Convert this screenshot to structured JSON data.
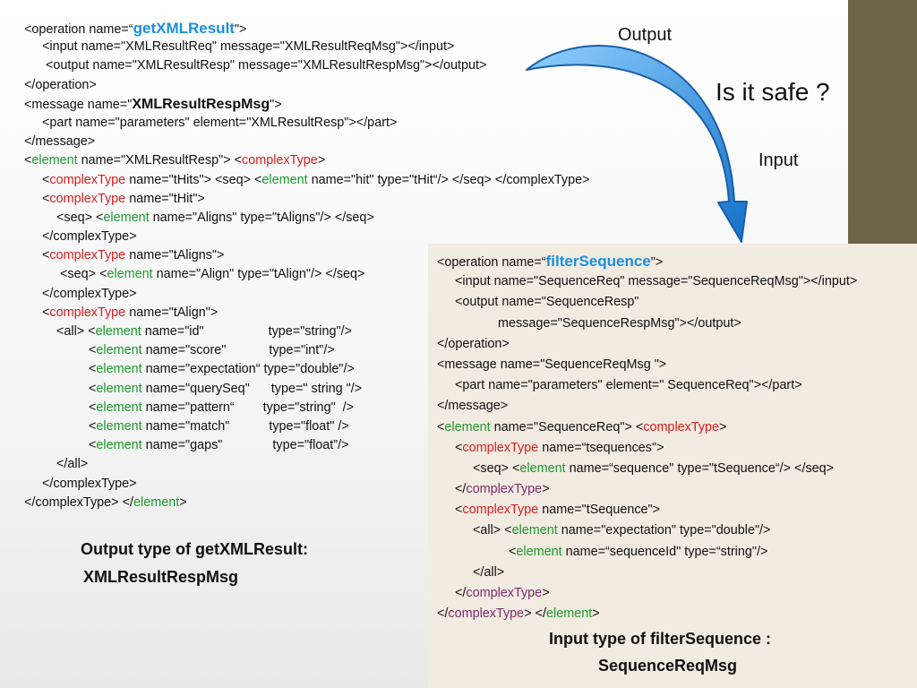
{
  "labels": {
    "output": "Output",
    "input": "Input",
    "question": "Is it safe ?"
  },
  "left_code": [
    [
      {
        "t": "<operation name=“"
      },
      {
        "t": "getXMLResult",
        "c": "hl"
      },
      {
        "t": "\">"
      }
    ],
    [
      {
        "t": "     <input name=\"XMLResultReq\" message=\"XMLResultReqMsg\"></input>"
      }
    ],
    [
      {
        "t": "      <output name=\"XMLResultResp\" message=\"XMLResultRespMsg\"></output>"
      }
    ],
    [
      {
        "t": "</operation>"
      }
    ],
    [
      {
        "t": "<message name=\""
      },
      {
        "t": "XMLResultRespMsg",
        "c": "bold"
      },
      {
        "t": "\">"
      }
    ],
    [
      {
        "t": "     <part name=\"parameters\" element=\"XMLResultResp\"></part>"
      }
    ],
    [
      {
        "t": "</message>"
      }
    ],
    [
      {
        "t": "<"
      },
      {
        "t": "element",
        "c": "kw-green"
      },
      {
        "t": " name=\"XMLResultResp\"> <"
      },
      {
        "t": "complexType",
        "c": "kw-red"
      },
      {
        "t": ">"
      }
    ],
    [
      {
        "t": "     <"
      },
      {
        "t": "complexType",
        "c": "kw-red"
      },
      {
        "t": " name=\"tHits\"> <seq> <"
      },
      {
        "t": "element",
        "c": "kw-green"
      },
      {
        "t": " name=\"hit\" type=\"tHit“/> </seq> </complexType>"
      }
    ],
    [
      {
        "t": "     <"
      },
      {
        "t": "complexType",
        "c": "kw-red"
      },
      {
        "t": " name=\"tHit\">"
      }
    ],
    [
      {
        "t": "         <seq> <"
      },
      {
        "t": "element",
        "c": "kw-green"
      },
      {
        "t": " name=\"Aligns\" type=\"tAligns\"/> </seq>"
      }
    ],
    [
      {
        "t": "     </complexType>"
      }
    ],
    [
      {
        "t": "     <"
      },
      {
        "t": "complexType",
        "c": "kw-red"
      },
      {
        "t": " name=\"tAligns\">"
      }
    ],
    [
      {
        "t": "          <seq> <"
      },
      {
        "t": "element",
        "c": "kw-green"
      },
      {
        "t": " name=\"Align\" type=\"tAlign\"/> </seq>"
      }
    ],
    [
      {
        "t": "     </complexType>"
      }
    ],
    [
      {
        "t": "     <"
      },
      {
        "t": "complexType",
        "c": "kw-red"
      },
      {
        "t": " name=\"tAlign\">"
      }
    ],
    [
      {
        "t": "         <all> <"
      },
      {
        "t": "element",
        "c": "kw-green"
      },
      {
        "t": " name=\"id\"                  type=\"string\"/>"
      }
    ],
    [
      {
        "t": "                  <"
      },
      {
        "t": "element",
        "c": "kw-green"
      },
      {
        "t": " name=\"score\"            type=\"int\"/>"
      }
    ],
    [
      {
        "t": "                  <"
      },
      {
        "t": "element",
        "c": "kw-green"
      },
      {
        "t": " name=\"expectation“ type=\"double\"/>"
      }
    ],
    [
      {
        "t": "                  <"
      },
      {
        "t": "element",
        "c": "kw-green"
      },
      {
        "t": " name=\"querySeq\"      type=\" string \"/>"
      }
    ],
    [
      {
        "t": "                  <"
      },
      {
        "t": "element",
        "c": "kw-green"
      },
      {
        "t": " name=\"pattern“        type=\"string\"  />"
      }
    ],
    [
      {
        "t": "                  <"
      },
      {
        "t": "element",
        "c": "kw-green"
      },
      {
        "t": " name=\"match\"           type=\"float\" />"
      }
    ],
    [
      {
        "t": "                  <"
      },
      {
        "t": "element",
        "c": "kw-green"
      },
      {
        "t": " name=\"gaps\"              type=\"float”/>"
      }
    ],
    [
      {
        "t": "         </all>"
      }
    ],
    [
      {
        "t": "     </complexType>"
      }
    ],
    [
      {
        "t": "</complexType> </"
      },
      {
        "t": "element",
        "c": "kw-green"
      },
      {
        "t": ">"
      }
    ]
  ],
  "right_code": [
    [
      {
        "t": "<operation name=“"
      },
      {
        "t": "filterSequence",
        "c": "hl"
      },
      {
        "t": "\">"
      }
    ],
    [
      {
        "t": "     <input name=\"SequenceReq\" message=\"SequenceReqMsg\"></input>"
      }
    ],
    [
      {
        "t": "     <output name=\"SequenceResp\""
      }
    ],
    [
      {
        "t": "                 message=\"SequenceRespMsg\"></output>"
      }
    ],
    [
      {
        "t": "</operation>"
      }
    ],
    [
      {
        "t": "<message name=\"SequenceReqMsg \">"
      }
    ],
    [
      {
        "t": "     <part name=\"parameters\" element=\" SequenceReq\"></part>"
      }
    ],
    [
      {
        "t": "</message>"
      }
    ],
    [
      {
        "t": "<"
      },
      {
        "t": "element",
        "c": "kw-green"
      },
      {
        "t": " name=\"SequenceReq\"> <"
      },
      {
        "t": "complexType",
        "c": "kw-red"
      },
      {
        "t": ">"
      }
    ],
    [
      {
        "t": "     <"
      },
      {
        "t": "complexType",
        "c": "kw-red"
      },
      {
        "t": " name=“tsequences\">"
      }
    ],
    [
      {
        "t": "          <seq> <"
      },
      {
        "t": "element",
        "c": "kw-green"
      },
      {
        "t": " name=“sequence\" type=\"tSequence“/> </seq>"
      }
    ],
    [
      {
        "t": "     </"
      },
      {
        "t": "complexType",
        "c": "kw-purple"
      },
      {
        "t": ">"
      }
    ],
    [
      {
        "t": "     <"
      },
      {
        "t": "complexType",
        "c": "kw-red"
      },
      {
        "t": " name=\"tSequence\">"
      }
    ],
    [
      {
        "t": "          <all> <"
      },
      {
        "t": "element",
        "c": "kw-green"
      },
      {
        "t": " name=\"expectation\" type=\"double\"/>"
      }
    ],
    [
      {
        "t": "                    <"
      },
      {
        "t": "element",
        "c": "kw-green"
      },
      {
        "t": " name=“sequenceId\" type=“string\"/>"
      }
    ],
    [
      {
        "t": "          </all>"
      }
    ],
    [
      {
        "t": "     </"
      },
      {
        "t": "complexType",
        "c": "kw-purple"
      },
      {
        "t": ">"
      }
    ],
    [
      {
        "t": "</"
      },
      {
        "t": "complexType",
        "c": "kw-purple"
      },
      {
        "t": "> </"
      },
      {
        "t": "element",
        "c": "kw-green"
      },
      {
        "t": ">"
      }
    ]
  ],
  "captions": {
    "left_line1": "Output type of getXMLResult:",
    "left_line2": "XMLResultRespMsg",
    "right_line1": "Input type of filterSequence :",
    "right_line2": "SequenceReqMsg"
  },
  "colors": {
    "highlight": "#1a8fe0",
    "element_keyword": "#1c9a2d",
    "complexType_keyword": "#d81e1e",
    "arrow": "#1e88d8",
    "side_bar": "#6b6446",
    "panel": "#f2ebe1"
  }
}
